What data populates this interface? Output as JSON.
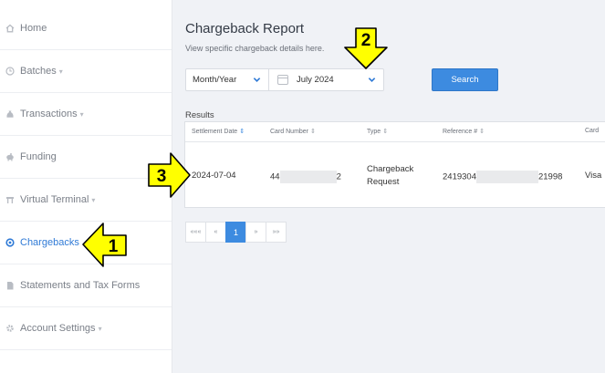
{
  "sidebar": {
    "items": [
      {
        "label": "Home",
        "icon": "home-icon",
        "caret": false,
        "active": false
      },
      {
        "label": "Batches",
        "icon": "clock-icon",
        "caret": true,
        "active": false
      },
      {
        "label": "Transactions",
        "icon": "moneybag-icon",
        "caret": true,
        "active": false
      },
      {
        "label": "Funding",
        "icon": "piggybank-icon",
        "caret": false,
        "active": false
      },
      {
        "label": "Virtual Terminal",
        "icon": "terminal-icon",
        "caret": true,
        "active": false
      },
      {
        "label": "Chargebacks",
        "icon": "refresh-icon",
        "caret": false,
        "active": true
      },
      {
        "label": "Statements and Tax Forms",
        "icon": "document-icon",
        "caret": false,
        "active": false
      },
      {
        "label": "Account Settings",
        "icon": "gear-icon",
        "caret": true,
        "active": false
      }
    ],
    "caret_glyph": "▾"
  },
  "main": {
    "title": "Chargeback Report",
    "subtitle": "View specific chargeback details here.",
    "period_select": "Month/Year",
    "date_select": "July 2024",
    "search_label": "Search",
    "results_label": "Results"
  },
  "table": {
    "columns": [
      "Settlement Date",
      "Card Number",
      "Type",
      "Reference #",
      "Card"
    ],
    "rows": [
      {
        "settlement_date": "2024-07-04",
        "card_prefix": "44",
        "card_suffix": "2",
        "type_line1": "Chargeback",
        "type_line2": "Request",
        "ref_prefix": "2419304",
        "ref_suffix": "21998",
        "card_brand": "Visa"
      }
    ]
  },
  "pagination": {
    "first": "«««",
    "prev": "«",
    "current": "1",
    "next": "»",
    "last": "»»"
  },
  "callouts": {
    "one": "1",
    "two": "2",
    "three": "3",
    "fill_color": "#ffff00"
  },
  "colors": {
    "accent": "#3d8be0",
    "active_nav": "#2f7ad6",
    "background": "#f0f2f6"
  }
}
